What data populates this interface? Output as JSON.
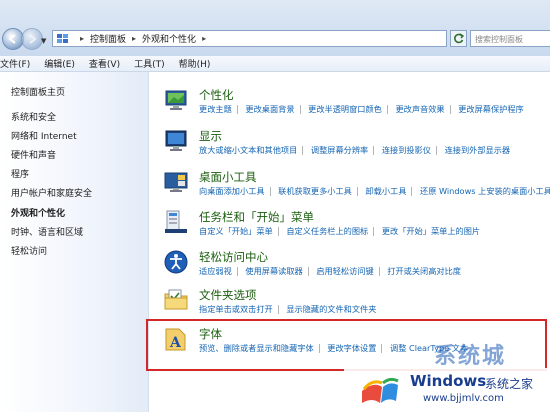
{
  "address_bar": {
    "breadcrumb": [
      "控制面板",
      "外观和个性化"
    ],
    "search_placeholder": "搜索控制面板"
  },
  "menu": [
    "文件(F)",
    "编辑(E)",
    "查看(V)",
    "工具(T)",
    "帮助(H)"
  ],
  "sidebar": {
    "items": [
      {
        "label": "控制面板主页",
        "active": false
      },
      {
        "label": "系统和安全",
        "active": false
      },
      {
        "label": "网络和 Internet",
        "active": false
      },
      {
        "label": "硬件和声音",
        "active": false
      },
      {
        "label": "程序",
        "active": false
      },
      {
        "label": "用户帐户和家庭安全",
        "active": false
      },
      {
        "label": "外观和个性化",
        "active": true
      },
      {
        "label": "时钟、语言和区域",
        "active": false
      },
      {
        "label": "轻松访问",
        "active": false
      }
    ]
  },
  "categories": [
    {
      "title": "个性化",
      "icon": "personalization-icon",
      "links": [
        "更改主题",
        "更改桌面背景",
        "更改半透明窗口颜色",
        "更改声音效果",
        "更改屏幕保护程序"
      ]
    },
    {
      "title": "显示",
      "icon": "display-icon",
      "links": [
        "放大或缩小文本和其他项目",
        "调整屏幕分辨率",
        "连接到投影仪",
        "连接到外部显示器"
      ]
    },
    {
      "title": "桌面小工具",
      "icon": "gadgets-icon",
      "links": [
        "向桌面添加小工具",
        "联机获取更多小工具",
        "卸载小工具",
        "还原 Windows 上安装的桌面小工具"
      ]
    },
    {
      "title": "任务栏和「开始」菜单",
      "icon": "taskbar-icon",
      "links": [
        "自定义「开始」菜单",
        "自定义任务栏上的图标",
        "更改「开始」菜单上的图片"
      ]
    },
    {
      "title": "轻松访问中心",
      "icon": "ease-of-access-icon",
      "links": [
        "适应弱视",
        "使用屏幕读取器",
        "启用轻松访问键",
        "打开或关闭高对比度"
      ]
    },
    {
      "title": "文件夹选项",
      "icon": "folder-options-icon",
      "links": [
        "指定单击或双击打开",
        "显示隐藏的文件和文件夹"
      ]
    },
    {
      "title": "字体",
      "icon": "fonts-icon",
      "links": [
        "预览、删除或者显示和隐藏字体",
        "更改字体设置",
        "调整 ClearType 文本"
      ]
    }
  ],
  "watermark": {
    "overlay": "系统城",
    "brand": "Windows",
    "brand_cn": "系统之家",
    "url": "www.bjjmlv.com"
  },
  "colors": {
    "link": "#1565b3",
    "category_title": "#1a5e0f",
    "highlight": "#d42828"
  }
}
